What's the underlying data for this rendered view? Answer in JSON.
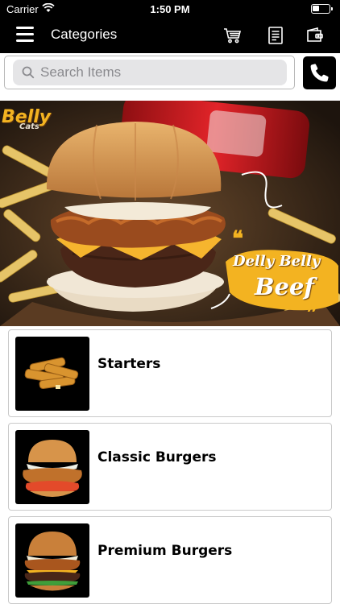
{
  "status_bar": {
    "carrier": "Carrier",
    "time": "1:50 PM"
  },
  "header": {
    "title": "Categories",
    "icons": [
      "menu-icon",
      "cart-icon",
      "orders-icon",
      "wallet-icon"
    ]
  },
  "search": {
    "placeholder": "Search Items",
    "value": ""
  },
  "banner": {
    "logo_text": "Belly",
    "logo_sub": "Cats",
    "title_line1": "Delly Belly",
    "title_line2": "Beef"
  },
  "categories": [
    {
      "name": "Starters",
      "thumb_icon": "mozzarella-sticks-image"
    },
    {
      "name": "Classic Burgers",
      "thumb_icon": "chicken-burger-image"
    },
    {
      "name": "Premium Burgers",
      "thumb_icon": "premium-burger-image"
    }
  ],
  "colors": {
    "header_bg": "#000000",
    "accent": "#f3b321",
    "search_bg": "#e5e5e7"
  }
}
